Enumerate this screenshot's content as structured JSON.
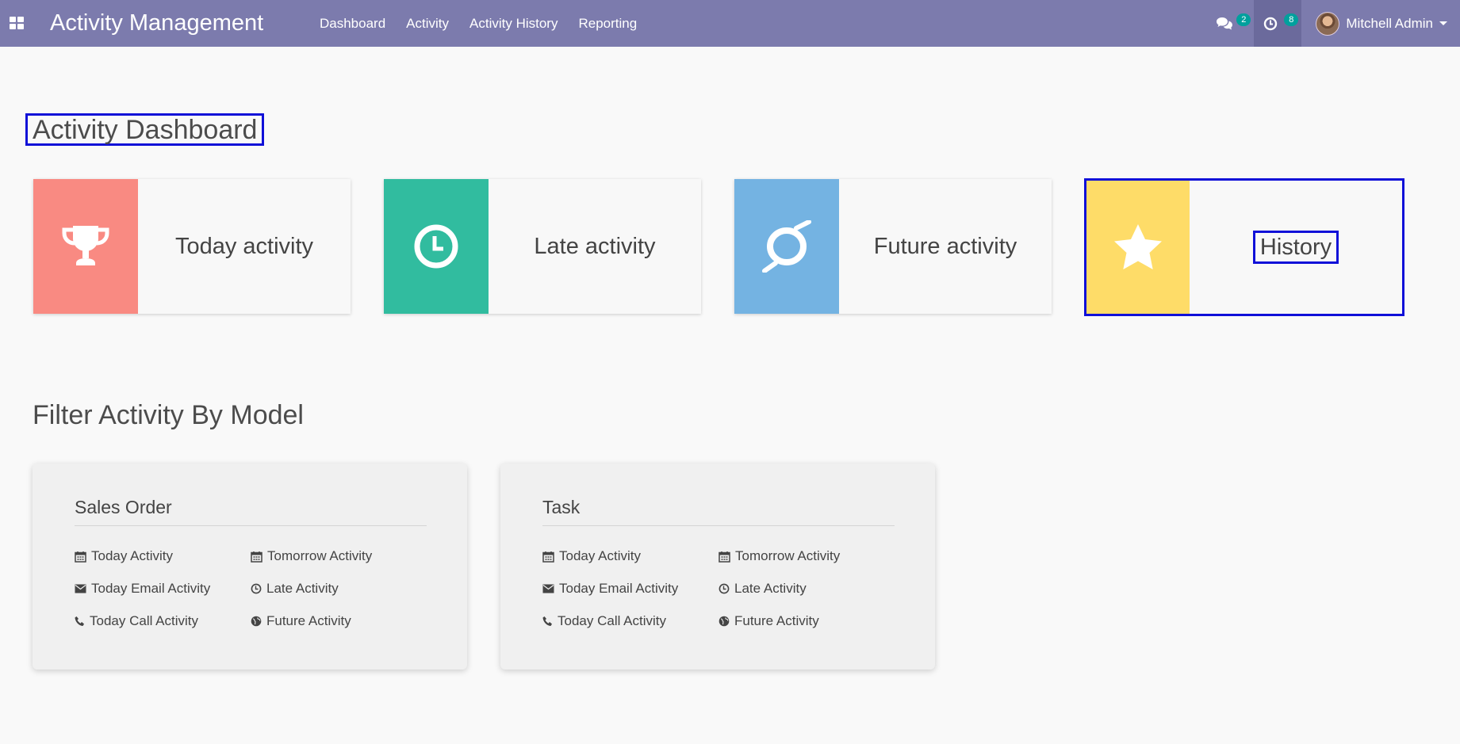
{
  "navbar": {
    "brand": "Activity Management",
    "menu": [
      "Dashboard",
      "Activity",
      "Activity History",
      "Reporting"
    ],
    "messages_count": "2",
    "activities_count": "8",
    "user_name": "Mitchell Admin"
  },
  "dashboard": {
    "title": "Activity Dashboard",
    "tiles": [
      {
        "label": "Today activity",
        "icon": "trophy-icon",
        "color": "#f98a82"
      },
      {
        "label": "Late activity",
        "icon": "clock-icon",
        "color": "#31bc9f"
      },
      {
        "label": "Future activity",
        "icon": "future-icon",
        "color": "#74b3e2"
      },
      {
        "label": "History",
        "icon": "star-icon",
        "color": "#fedc68"
      }
    ]
  },
  "filter": {
    "title": "Filter Activity By Model",
    "models": [
      {
        "name": "Sales Order",
        "links": {
          "today": "Today Activity",
          "tomorrow": "Tomorrow Activity",
          "email": "Today Email Activity",
          "late": "Late Activity",
          "call": "Today Call Activity",
          "future": "Future Activity"
        }
      },
      {
        "name": "Task",
        "links": {
          "today": "Today Activity",
          "tomorrow": "Tomorrow Activity",
          "email": "Today Email Activity",
          "late": "Late Activity",
          "call": "Today Call Activity",
          "future": "Future Activity"
        }
      }
    ]
  }
}
